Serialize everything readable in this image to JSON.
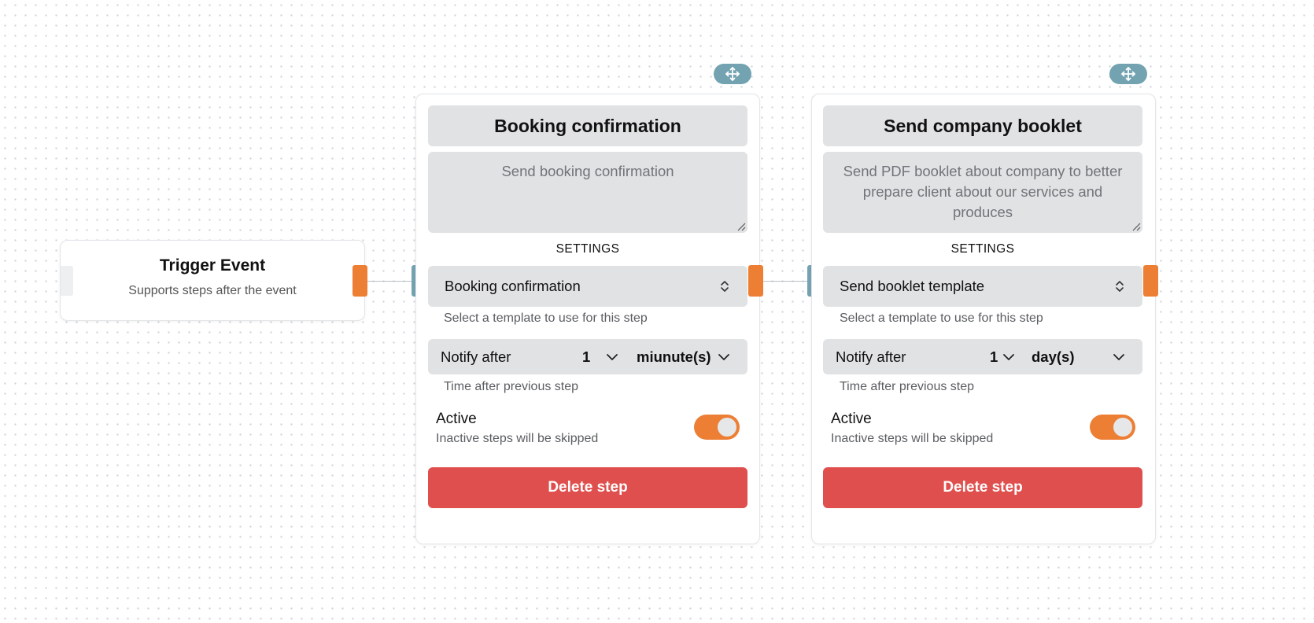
{
  "trigger": {
    "title": "Trigger Event",
    "subtitle": "Supports steps after the event"
  },
  "steps": [
    {
      "title": "Booking confirmation",
      "description": "Send booking confirmation",
      "settings_label": "SETTINGS",
      "template_value": "Booking confirmation",
      "template_hint": "Select a template to use for this step",
      "notify_label": "Notify after",
      "notify_amount": "1",
      "notify_unit": "miunute(s)",
      "notify_hint": "Time after previous step",
      "active_label": "Active",
      "active_hint": "Inactive steps will be skipped",
      "active": true,
      "delete_label": "Delete step"
    },
    {
      "title": "Send company booklet",
      "description": "Send PDF booklet about company to better prepare client about our services and produces",
      "settings_label": "SETTINGS",
      "template_value": "Send booklet template",
      "template_hint": "Select a template to use for this step",
      "notify_label": "Notify after",
      "notify_amount": "1",
      "notify_unit": "day(s)",
      "notify_hint": "Time after previous step",
      "active_label": "Active",
      "active_hint": "Inactive steps will be skipped",
      "active": true,
      "delete_label": "Delete step"
    }
  ],
  "icons": {
    "move": "move-arrows-icon",
    "select": "updown-chevron-icon",
    "dropdown": "chevron-down-icon"
  },
  "colors": {
    "accent_orange": "#ed7f35",
    "handle_in": "#73a3b1",
    "delete": "#df4f4d",
    "field_bg": "#e1e2e4"
  }
}
